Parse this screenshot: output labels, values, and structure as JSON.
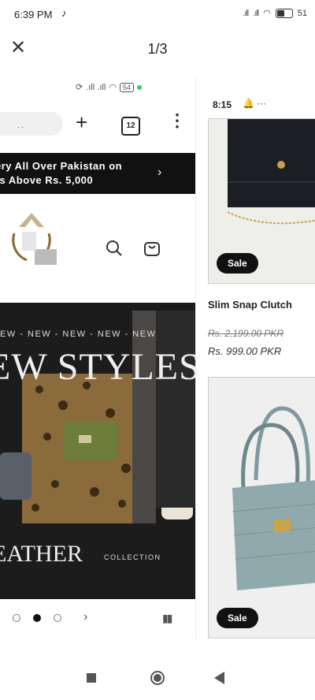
{
  "status_bar": {
    "time": "6:39 PM",
    "battery": "51"
  },
  "viewer": {
    "page_indicator": "1/3"
  },
  "left_shot": {
    "status_battery": "54",
    "tab_count": "12",
    "url_snippet": ". .",
    "promo_line1": "ery All Over Pakistan on",
    "promo_line2": "rs Above Rs. 5,000",
    "hero_tag": "EW - NEW - NEW - NEW - NEW",
    "hero_title": "EW STYLES",
    "hero_footer_big": "EATHER",
    "hero_footer_small": "COLLECTION"
  },
  "right_shot": {
    "time": "8:15",
    "status_extra": "🔔 ···",
    "products": [
      {
        "sale_label": "Sale",
        "name": "Slim Snap Clutch",
        "old_price": "Rs. 2,199.00 PKR",
        "new_price": "Rs. 999.00 PKR"
      },
      {
        "sale_label": "Sale"
      }
    ]
  },
  "colors": {
    "banner_bg": "#111111",
    "hero_bg": "#1b1b1b",
    "green_dot": "#2ecc71"
  }
}
